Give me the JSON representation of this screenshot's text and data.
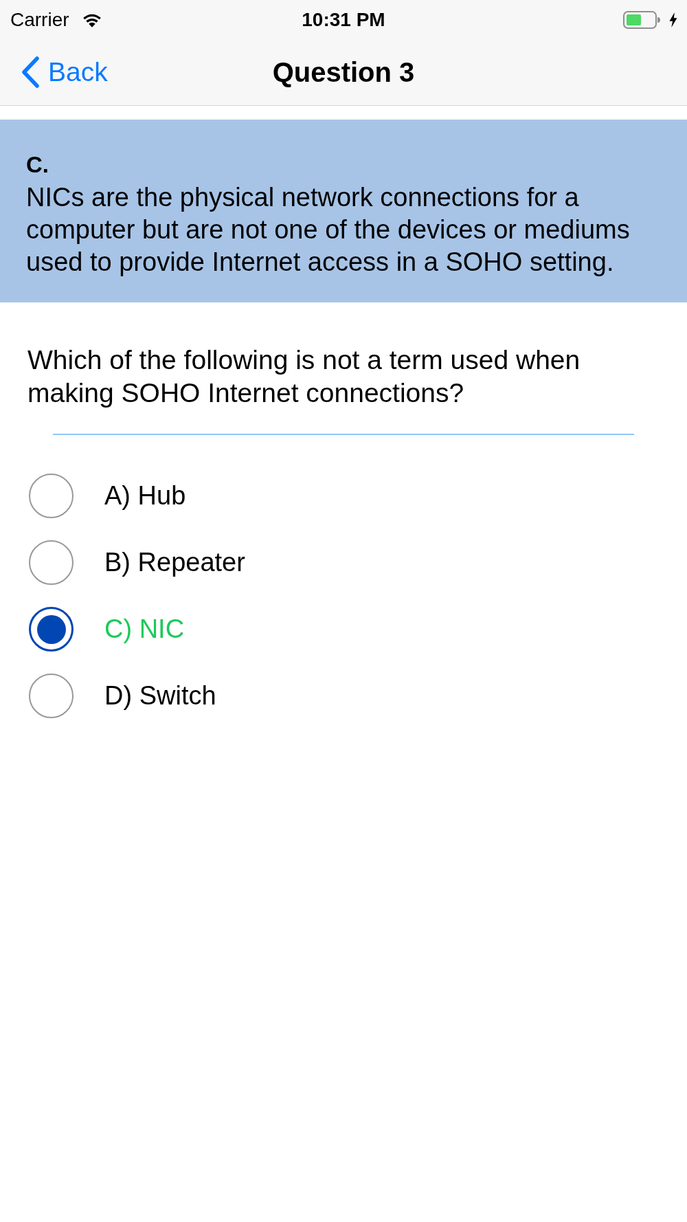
{
  "status_bar": {
    "carrier": "Carrier",
    "time": "10:31 PM"
  },
  "nav_bar": {
    "back": "Back",
    "title": "Question 3"
  },
  "explanation": {
    "answer": "C.",
    "text": "NICs are the physical network connections for a computer but are not one of the devices or mediums used to provide Internet access in a SOHO setting."
  },
  "question": "Which of the following is not a term used when making SOHO Internet connections?",
  "options": [
    {
      "label": "A) Hub",
      "selected": false,
      "correct": false
    },
    {
      "label": "B) Repeater",
      "selected": false,
      "correct": false
    },
    {
      "label": "C) NIC",
      "selected": true,
      "correct": true
    },
    {
      "label": "D) Switch",
      "selected": false,
      "correct": false
    }
  ]
}
